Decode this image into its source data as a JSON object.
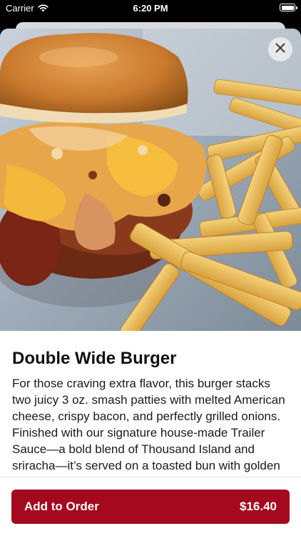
{
  "status_bar": {
    "carrier": "Carrier",
    "time": "6:20 PM"
  },
  "item": {
    "image_alt": "Double Wide Burger with fries",
    "title": "Double Wide Burger",
    "description": "For those craving extra flavor, this burger stacks two juicy 3 oz. smash patties with melted American cheese, crispy bacon, and perfectly grilled onions. Finished with our signature house-made Trailer Sauce—a bold blend of Thousand Island and sriracha—it’s served on a toasted bun with golden French fries or a fresh side salad. The"
  },
  "actions": {
    "add_label": "Add to Order",
    "price": "$16.40"
  },
  "icons": {
    "close": "close-icon",
    "wifi": "wifi-icon",
    "battery": "battery-icon"
  },
  "colors": {
    "accent": "#a4091d",
    "background": "#ffffff",
    "status_bar": "#000000"
  }
}
